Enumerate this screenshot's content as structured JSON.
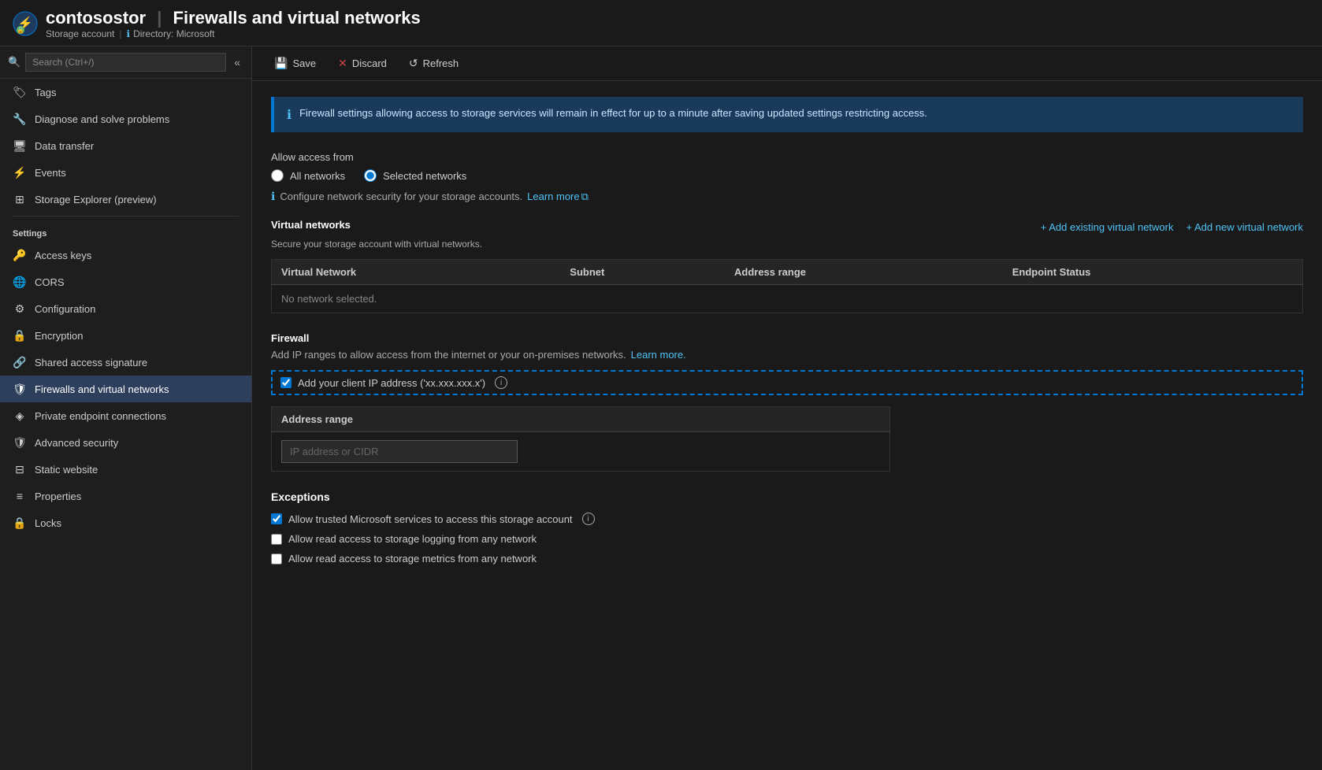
{
  "header": {
    "icon_color": "#5cb85c",
    "title": "contosostor",
    "separator": "|",
    "page_name": "Firewalls and virtual networks",
    "subtitle_type": "Storage account",
    "subtitle_sep": "|",
    "subtitle_dir_icon": "ℹ",
    "subtitle_dir": "Directory: Microsoft"
  },
  "search": {
    "placeholder": "Search (Ctrl+/)"
  },
  "collapse_btn": "«",
  "sidebar": {
    "items_top": [
      {
        "id": "tags",
        "icon": "🏷",
        "label": "Tags"
      },
      {
        "id": "diagnose",
        "icon": "🔧",
        "label": "Diagnose and solve problems"
      },
      {
        "id": "data-transfer",
        "icon": "🖥",
        "label": "Data transfer"
      },
      {
        "id": "events",
        "icon": "⚡",
        "label": "Events"
      },
      {
        "id": "storage-explorer",
        "icon": "⊞",
        "label": "Storage Explorer (preview)"
      }
    ],
    "settings_label": "Settings",
    "settings_items": [
      {
        "id": "access-keys",
        "icon": "🔑",
        "label": "Access keys"
      },
      {
        "id": "cors",
        "icon": "🌐",
        "label": "CORS"
      },
      {
        "id": "configuration",
        "icon": "⚙",
        "label": "Configuration"
      },
      {
        "id": "encryption",
        "icon": "🔒",
        "label": "Encryption"
      },
      {
        "id": "shared-access",
        "icon": "🔗",
        "label": "Shared access signature"
      },
      {
        "id": "firewalls",
        "icon": "🛡",
        "label": "Firewalls and virtual networks",
        "active": true
      },
      {
        "id": "private-endpoint",
        "icon": "◈",
        "label": "Private endpoint connections"
      },
      {
        "id": "advanced-security",
        "icon": "🛡",
        "label": "Advanced security"
      },
      {
        "id": "static-website",
        "icon": "⊟",
        "label": "Static website"
      },
      {
        "id": "properties",
        "icon": "≡",
        "label": "Properties"
      },
      {
        "id": "locks",
        "icon": "🔒",
        "label": "Locks"
      }
    ]
  },
  "toolbar": {
    "save_label": "Save",
    "save_icon": "💾",
    "discard_label": "Discard",
    "discard_icon": "✕",
    "refresh_label": "Refresh",
    "refresh_icon": "↺"
  },
  "content": {
    "info_banner": "Firewall settings allowing access to storage services will remain in effect for up to a minute after saving updated settings restricting access.",
    "allow_access_label": "Allow access from",
    "radio_all": "All networks",
    "radio_selected": "Selected networks",
    "configure_note": "Configure network security for your storage accounts.",
    "learn_more": "Learn more",
    "learn_more_icon": "⧉",
    "virtual_networks": {
      "title": "Virtual networks",
      "subtitle": "Secure your storage account with virtual networks.",
      "add_existing": "+ Add existing virtual network",
      "add_new": "+ Add new virtual network",
      "columns": [
        "Virtual Network",
        "Subnet",
        "Address range",
        "Endpoint Status"
      ],
      "no_network": "No network selected."
    },
    "firewall": {
      "title": "Firewall",
      "desc": "Add IP ranges to allow access from the internet or your on-premises networks.",
      "learn_more": "Learn more.",
      "checkbox_client_ip": "Add your client IP address ('xx.xxx.xxx.x')",
      "address_range_col": "Address range",
      "ip_placeholder": "IP address or CIDR"
    },
    "exceptions": {
      "title": "Exceptions",
      "items": [
        {
          "id": "trusted-microsoft",
          "label": "Allow trusted Microsoft services to access this storage account",
          "checked": true,
          "has_info": true
        },
        {
          "id": "read-logging",
          "label": "Allow read access to storage logging from any network",
          "checked": false,
          "has_info": false
        },
        {
          "id": "read-metrics",
          "label": "Allow read access to storage metrics from any network",
          "checked": false,
          "has_info": false
        }
      ]
    }
  }
}
